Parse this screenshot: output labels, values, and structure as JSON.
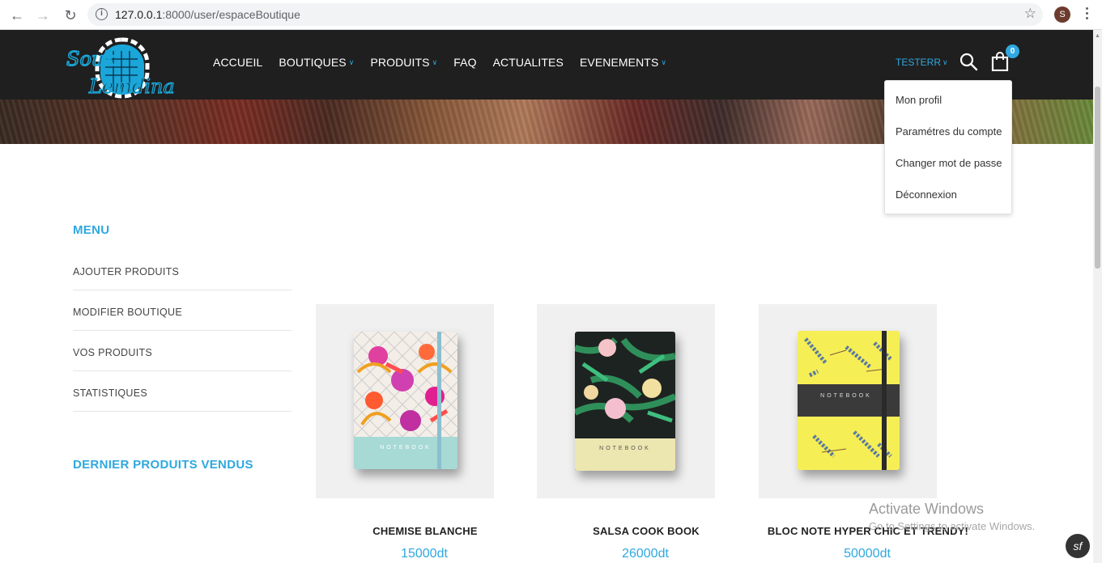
{
  "browser": {
    "url_host": "127.0.0.1",
    "url_path": ":8000/user/espaceBoutique",
    "profile_initial": "S"
  },
  "header": {
    "logo_icon": "souk-lemdina-logo",
    "nav": [
      {
        "label": "ACCUEIL",
        "dropdown": false
      },
      {
        "label": "BOUTIQUES",
        "dropdown": true
      },
      {
        "label": "PRODUITS",
        "dropdown": true
      },
      {
        "label": "FAQ",
        "dropdown": false
      },
      {
        "label": "ACTUALITES",
        "dropdown": false
      },
      {
        "label": "EVENEMENTS",
        "dropdown": true
      }
    ],
    "user_label": "TESTERR",
    "cart_count": "0"
  },
  "user_dropdown": {
    "items": [
      "Mon profil",
      "Paramétres du compte",
      "Changer mot de passe",
      "Déconnexion"
    ]
  },
  "sidebar": {
    "menu_title": "MENU",
    "items": [
      "AJOUTER PRODUITS",
      "MODIFIER BOUTIQUE",
      "VOS PRODUITS",
      "STATISTIQUES"
    ],
    "recent_title": "DERNIER PRODUITS VENDUS"
  },
  "products": [
    {
      "name": "CHEMISE BLANCHE",
      "price": "15000dt",
      "cover_label": "NOTEBOOK"
    },
    {
      "name": "SALSA COOK BOOK",
      "price": "26000dt",
      "cover_label": "NOTEBOOK"
    },
    {
      "name": "BLOC NOTE HYPER CHIC ET TRENDY!",
      "price": "50000dt",
      "cover_label": "NOTEBOOK"
    }
  ],
  "watermark": {
    "line1": "Activate Windows",
    "line2": "Go to Settings to activate Windows."
  },
  "colors": {
    "accent": "#2fa8e0",
    "header_bg": "#1f1f1f"
  }
}
